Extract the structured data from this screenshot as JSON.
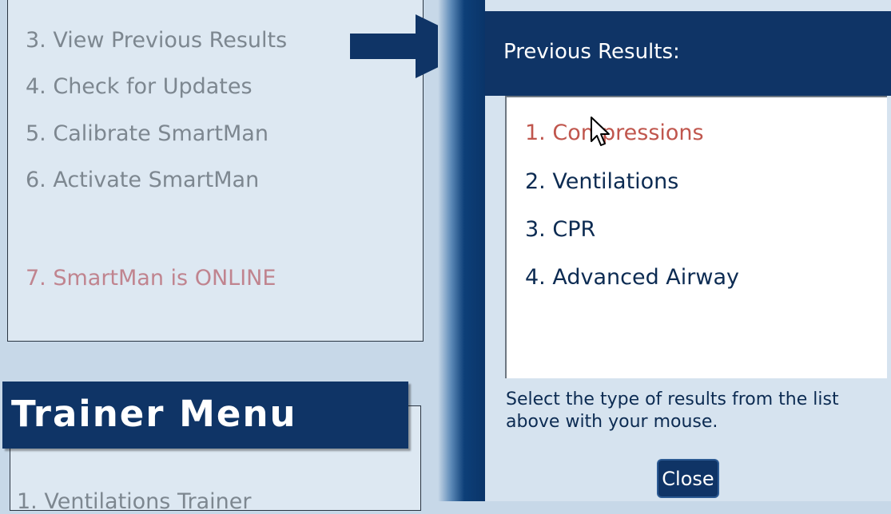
{
  "main_menu": {
    "items": [
      {
        "label": "3. View Previous Results"
      },
      {
        "label": "4. Check for Updates"
      },
      {
        "label": "5. Calibrate SmartMan"
      },
      {
        "label": "6. Activate SmartMan"
      },
      {
        "label": "7. SmartMan is ONLINE"
      }
    ]
  },
  "trainer_menu": {
    "title": "Trainer Menu",
    "items": [
      {
        "label": "1. Ventilations Trainer"
      }
    ]
  },
  "results_panel": {
    "title": "Previous Results:",
    "items": [
      {
        "label": "1. Compressions"
      },
      {
        "label": "2. Ventilations"
      },
      {
        "label": "3. CPR"
      },
      {
        "label": "4. Advanced Airway"
      }
    ],
    "instructions": "Select the type of results from the list above with your mouse.",
    "close_label": "Close"
  },
  "colors": {
    "navy": "#0f3466",
    "highlight": "#c0564d",
    "menu_text": "#7d8790",
    "online": "#c0848f"
  },
  "icons": {
    "arrow": "right-arrow-icon",
    "cursor": "mouse-pointer-icon"
  }
}
